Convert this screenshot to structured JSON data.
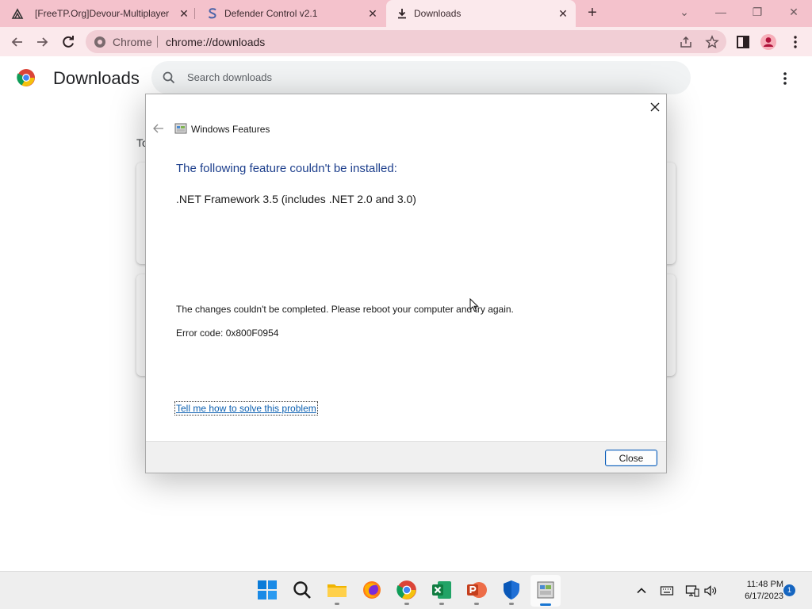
{
  "browser": {
    "tabs": [
      {
        "title": "[FreeTP.Org]Devour-Multiplayer",
        "icon": "freetp-icon",
        "active": false
      },
      {
        "title": "Defender Control v2.1",
        "icon": "s-icon",
        "active": false
      },
      {
        "title": "Downloads",
        "icon": "download-icon",
        "active": true
      }
    ],
    "omnibox": {
      "scheme_label": "Chrome",
      "url": "chrome://downloads"
    }
  },
  "downloads_page": {
    "title": "Downloads",
    "search_placeholder": "Search downloads",
    "date_label": "To"
  },
  "dialog": {
    "app_title": "Windows Features",
    "heading": "The following feature couldn't be installed:",
    "feature": ".NET Framework 3.5 (includes .NET 2.0 and 3.0)",
    "message": "The changes couldn't be completed. Please reboot your computer and try again.",
    "error_code": "Error code: 0x800F0954",
    "help_link": "Tell me how to solve this problem",
    "close_button": "Close"
  },
  "taskbar": {
    "apps": [
      "windows-start-icon",
      "search-icon",
      "file-explorer-icon",
      "firefox-icon",
      "chrome-icon",
      "excel-icon",
      "powerpoint-icon",
      "defender-icon",
      "windows-features-icon"
    ],
    "clock": {
      "time": "11:48 PM",
      "date": "6/17/2023"
    },
    "notification_count": "1"
  },
  "colors": {
    "tab_strip": "#f4c2cc",
    "toolbar": "#fbe9ec",
    "dialog_heading": "#1c3e8c",
    "link": "#0b5fb0",
    "accent": "#0a5cb8"
  }
}
